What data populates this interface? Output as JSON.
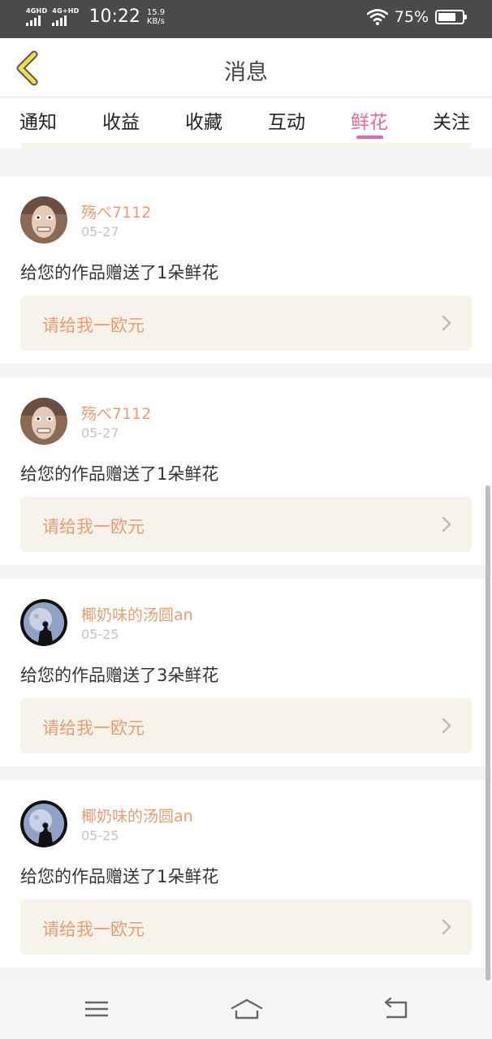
{
  "status_bar": {
    "sim1": "4G",
    "sim1_sup": "HD",
    "sim2": "4G+",
    "sim2_sup": "HD",
    "time": "10:22",
    "speed_value": "15.9",
    "speed_unit": "KB/s",
    "battery": "75%",
    "battery_level": 0.75
  },
  "header": {
    "title": "消息",
    "back_icon": "chevron-left-icon"
  },
  "tabs": [
    {
      "label": "通知",
      "active": false
    },
    {
      "label": "收益",
      "active": false
    },
    {
      "label": "收藏",
      "active": false
    },
    {
      "label": "互动",
      "active": false
    },
    {
      "label": "鲜花",
      "active": true
    },
    {
      "label": "关注",
      "active": false
    }
  ],
  "messages": [
    {
      "user": "殇べ7112",
      "date": "05-27",
      "text": "给您的作品赠送了1朵鲜花",
      "reply": "请给我一欧元",
      "avatar": "grinning-face-avatar"
    },
    {
      "user": "殇べ7112",
      "date": "05-27",
      "text": "给您的作品赠送了1朵鲜花",
      "reply": "请给我一欧元",
      "avatar": "grinning-face-avatar"
    },
    {
      "user": "椰奶味的汤圆an",
      "date": "05-25",
      "text": "给您的作品赠送了3朵鲜花",
      "reply": "请给我一欧元",
      "avatar": "moon-silhouette-avatar"
    },
    {
      "user": "椰奶味的汤圆an",
      "date": "05-25",
      "text": "给您的作品赠送了1朵鲜花",
      "reply": "请给我一欧元",
      "avatar": "moon-silhouette-avatar"
    }
  ],
  "nav": {
    "menu_icon": "menu-icon",
    "home_icon": "home-icon",
    "back_icon": "back-arrow-icon"
  },
  "colors": {
    "accent": "#e7679b",
    "name": "#ec9c6e",
    "reply_bg": "#f5f3ea",
    "status_bar": "#4a4a4a",
    "back_icon": "#f2e04a"
  }
}
